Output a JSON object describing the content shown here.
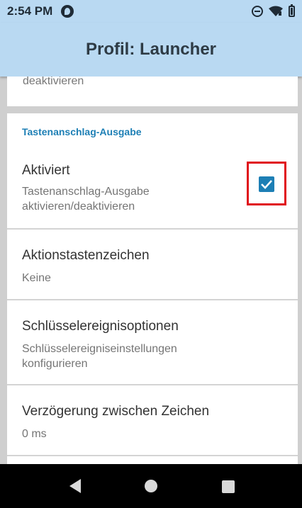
{
  "status_bar": {
    "time": "2:54 PM",
    "icons": [
      "app-notification-icon",
      "do-not-disturb-icon",
      "wifi-icon",
      "battery-icon"
    ]
  },
  "app_bar": {
    "title": "Profil: Launcher"
  },
  "previous_card": {
    "summary_tail": "deaktivieren"
  },
  "section": {
    "header": "Tastenanschlag-Ausgabe",
    "items": [
      {
        "title": "Aktiviert",
        "summary": "Tastenanschlag-Ausgabe aktivieren/deaktivieren",
        "checked": true
      },
      {
        "title": "Aktionstastenzeichen",
        "summary": "Keine"
      },
      {
        "title": "Schlüsselereignisoptionen",
        "summary": "Schlüsselereigniseinstellungen konfigurieren"
      },
      {
        "title": "Verzögerung zwischen Zeichen",
        "summary": "0 ms"
      }
    ]
  },
  "colors": {
    "app_bar": "#b9d9f2",
    "accent": "#1d7fb5",
    "highlight": "#e0101a",
    "background": "#cfcfcf"
  },
  "nav_bar": {
    "icons": [
      "back-icon",
      "home-icon",
      "recents-icon"
    ]
  }
}
